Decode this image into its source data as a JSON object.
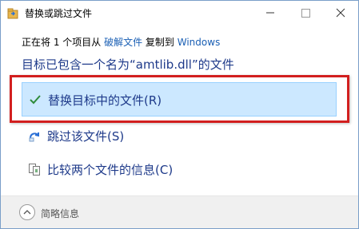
{
  "window": {
    "title": "替换或跳过文件",
    "minimize_icon": "minimize-icon",
    "maximize_icon": "maximize-icon",
    "close_icon": "close-icon"
  },
  "info": {
    "prefix": "正在将 1 个项目从 ",
    "source": "破解文件",
    "middle": " 复制到 ",
    "destination": "Windows"
  },
  "heading": "目标已包含一个名为“amtlib.dll”的文件",
  "options": {
    "replace_label": "替换目标中的文件(R)",
    "skip_label": "跳过该文件(S)",
    "compare_label": "比较两个文件的信息(C)"
  },
  "footer": {
    "details_label": "简略信息"
  },
  "colors": {
    "accent_text": "#1e3a8a",
    "link": "#1a5fb4",
    "selection_bg": "#cce8ff",
    "highlight_border": "#d21f1f",
    "check_green": "#2e8b3a"
  }
}
